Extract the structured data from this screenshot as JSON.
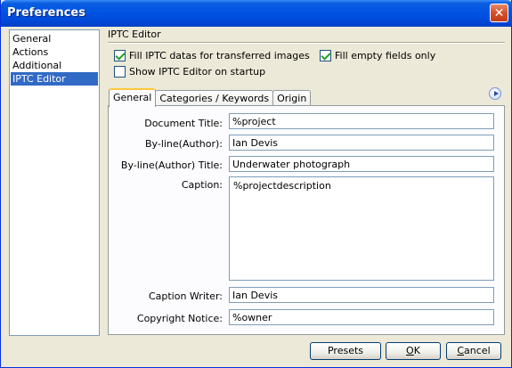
{
  "window": {
    "title": "Preferences"
  },
  "sidebar": {
    "items": [
      {
        "label": "General"
      },
      {
        "label": "Actions"
      },
      {
        "label": "Additional"
      },
      {
        "label": "IPTC Editor",
        "selected": true
      }
    ]
  },
  "section": {
    "title": "IPTC Editor"
  },
  "options": {
    "fill_iptc": {
      "label": "Fill IPTC datas for transferred images",
      "checked": true
    },
    "fill_empty": {
      "label": "Fill empty fields only",
      "checked": true
    },
    "show_editor": {
      "label": "Show IPTC Editor on startup",
      "checked": false
    }
  },
  "tabs": [
    {
      "label": "General",
      "active": true
    },
    {
      "label": "Categories / Keywords"
    },
    {
      "label": "Origin"
    }
  ],
  "form": {
    "document_title": {
      "label": "Document Title:",
      "value": "%project"
    },
    "byline": {
      "label": "By-line(Author):",
      "value": "Ian Devis"
    },
    "byline_title": {
      "label": "By-line(Author) Title:",
      "value": "Underwater photograph"
    },
    "caption": {
      "label": "Caption:",
      "value": "%projectdescription"
    },
    "caption_writer": {
      "label": "Caption Writer:",
      "value": "Ian Devis"
    },
    "copyright": {
      "label": "Copyright Notice:",
      "value": "%owner"
    }
  },
  "buttons": {
    "presets": "Presets",
    "ok_pre": "",
    "ok_accel": "O",
    "ok_post": "K",
    "cancel_accel": "C",
    "cancel_post": "ancel"
  }
}
